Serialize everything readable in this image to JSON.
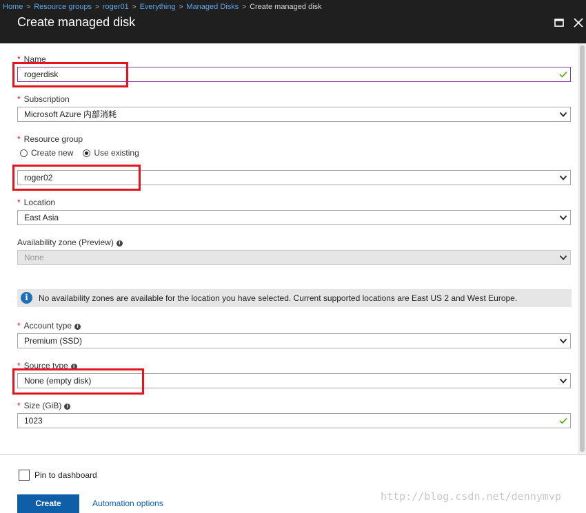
{
  "breadcrumb": {
    "items": [
      "Home",
      "Resource groups",
      "roger01",
      "Everything",
      "Managed Disks"
    ],
    "current": "Create managed disk"
  },
  "header": {
    "title": "Create managed disk",
    "maximize_icon": "maximize-icon",
    "close_icon": "close-icon"
  },
  "form": {
    "required_marker": "*",
    "name": {
      "label": "Name",
      "value": "rogerdisk"
    },
    "subscription": {
      "label": "Subscription",
      "value": "Microsoft Azure 内部消耗"
    },
    "resource_group": {
      "label": "Resource group",
      "options": [
        "Create new",
        "Use existing"
      ],
      "selected_option": "Use existing",
      "value": "roger02"
    },
    "location": {
      "label": "Location",
      "value": "East Asia"
    },
    "availability_zone": {
      "label": "Availability zone (Preview)",
      "value": "None"
    },
    "info_banner": "No availability zones are available for the location you have selected. Current supported locations are East US 2 and West Europe.",
    "account_type": {
      "label": "Account type",
      "value": "Premium (SSD)"
    },
    "source_type": {
      "label": "Source type",
      "value": "None (empty disk)"
    },
    "size": {
      "label": "Size (GiB)",
      "value": "1023"
    }
  },
  "footer": {
    "pin_label": "Pin to dashboard",
    "create_label": "Create",
    "automation_label": "Automation options"
  },
  "watermark": "http://blog.csdn.net/dennymvp",
  "colors": {
    "header_bg": "#1f1f1f",
    "link": "#5ea7e6",
    "required": "#e81123",
    "primary_button": "#0f5ea8",
    "highlight_box": "#e3141d"
  }
}
